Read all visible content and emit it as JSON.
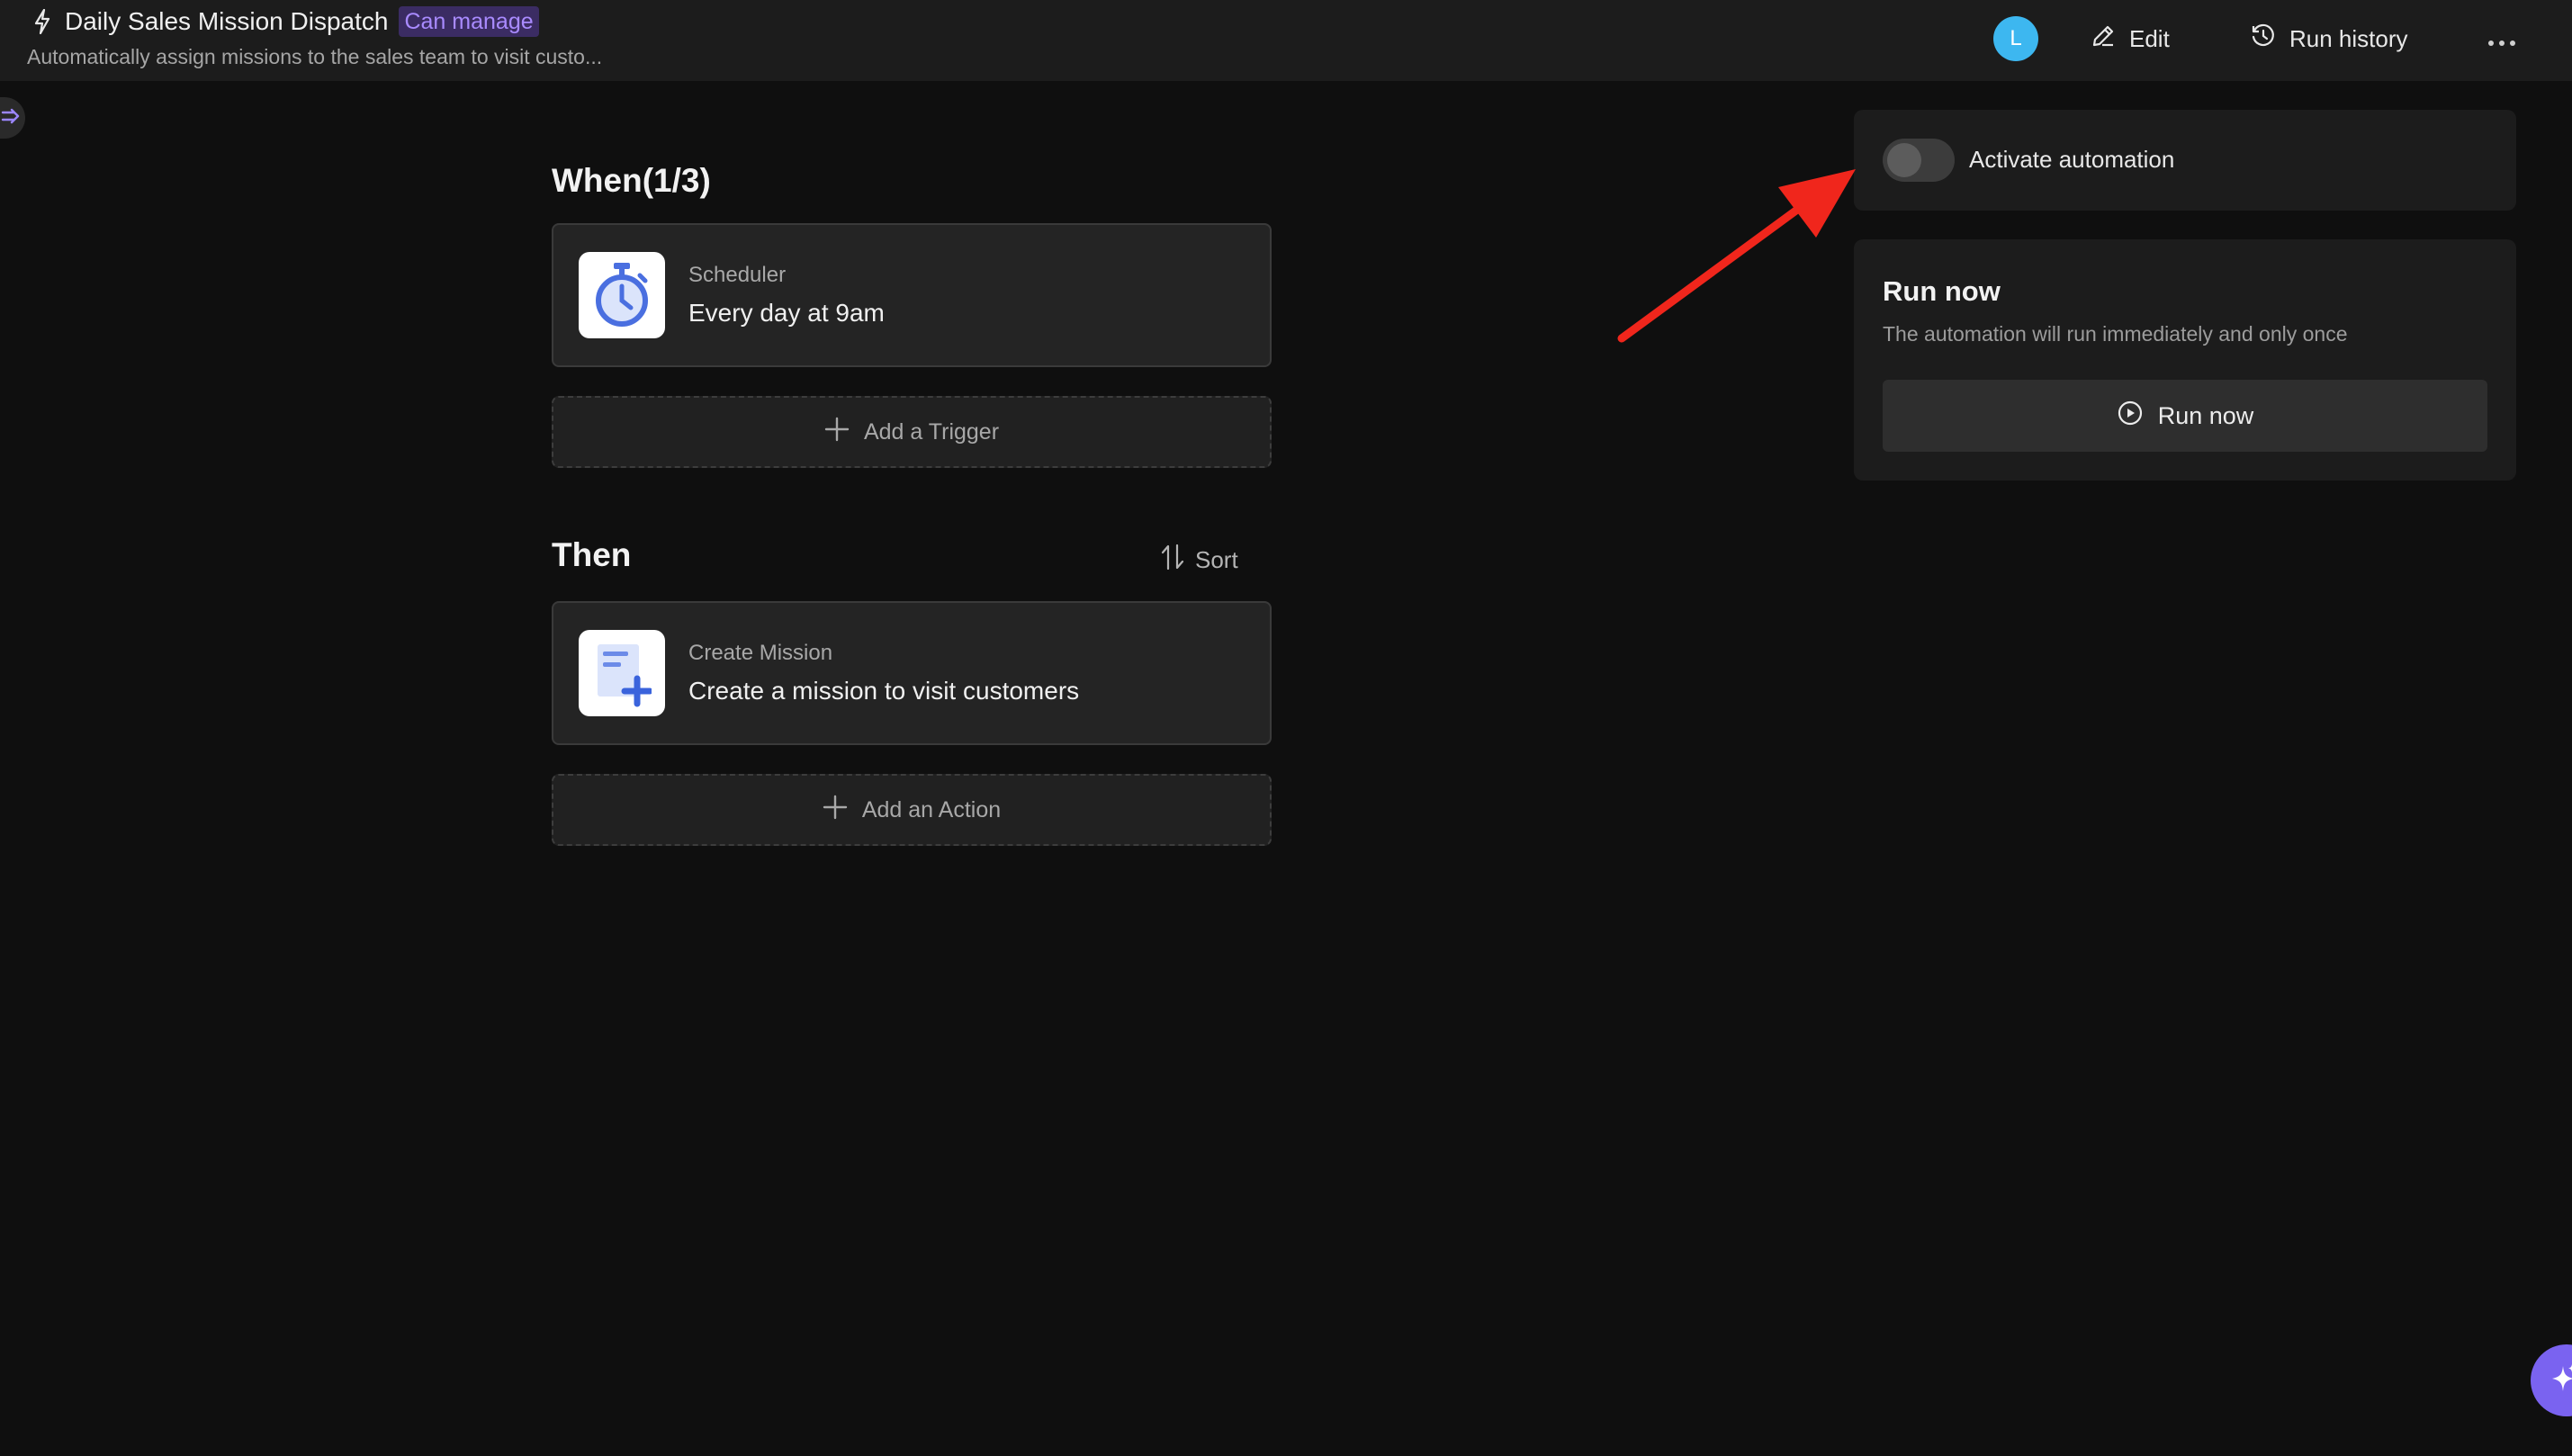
{
  "header": {
    "title": "Daily Sales Mission Dispatch",
    "permission_badge": "Can manage",
    "subtitle": "Automatically assign missions to the sales team to visit custo...",
    "avatar_initial": "L",
    "edit_label": "Edit",
    "run_history_label": "Run history"
  },
  "when": {
    "title": "When(1/3)",
    "trigger": {
      "label": "Scheduler",
      "value": "Every day at 9am",
      "icon": "timer-icon"
    },
    "add_label": "Add a Trigger"
  },
  "then": {
    "title": "Then",
    "sort_label": "Sort",
    "action": {
      "label": "Create Mission",
      "value": "Create a mission to visit customers",
      "icon": "create-mission-icon"
    },
    "add_label": "Add an Action"
  },
  "activate": {
    "label": "Activate automation",
    "enabled": false
  },
  "run_now": {
    "title": "Run now",
    "description": "The automation will run immediately and only once",
    "button_label": "Run now"
  },
  "colors": {
    "accent": "#7a63f0",
    "badge_bg": "#3b2c63",
    "badge_text": "#a98bff",
    "avatar": "#3db7f0",
    "annotation_arrow": "#f0261c"
  }
}
